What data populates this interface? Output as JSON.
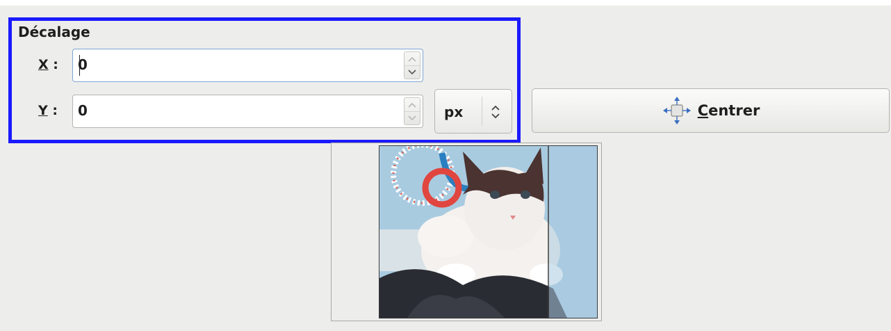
{
  "offset_group": {
    "title": "Décalage",
    "x": {
      "label_mnemonic": "X",
      "label_rest": " :",
      "value": "0"
    },
    "y": {
      "label_mnemonic": "Y",
      "label_rest": " :",
      "value": "0"
    }
  },
  "unit_selector": {
    "selected": "px",
    "arrows_icon": "up-down-arrows-icon"
  },
  "center_button": {
    "label_mnemonic": "C",
    "label_rest": "entrer",
    "icon": "center-move-icon"
  },
  "preview": {
    "subject": "cat photo preview"
  },
  "colors": {
    "highlight_border": "#1a1aff",
    "window_bg": "#ededeb",
    "focus_border": "#7ea6d6"
  }
}
